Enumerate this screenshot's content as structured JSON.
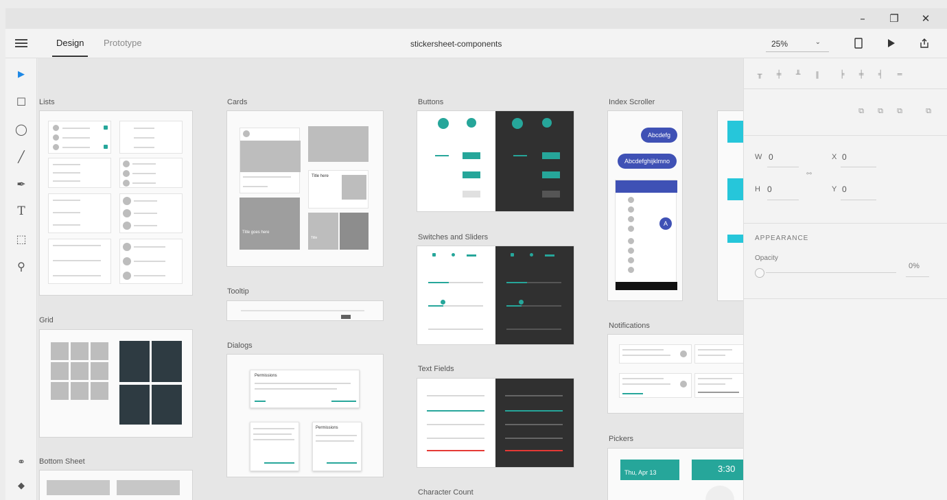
{
  "window": {
    "minimize": "–",
    "restore": "❐",
    "close": "✕"
  },
  "topbar": {
    "tabs": [
      {
        "label": "Design",
        "active": true
      },
      {
        "label": "Prototype",
        "active": false
      }
    ],
    "document_title": "stickersheet-components",
    "zoom": "25%",
    "zoom_chevron": "⌄",
    "device_icon": "device-preview-icon",
    "play_icon": "play-icon",
    "share_icon": "share-icon"
  },
  "tools": [
    {
      "name": "select-tool",
      "icon": "arrow-icon",
      "glyph": "▶"
    },
    {
      "name": "rectangle-tool",
      "icon": "rectangle-icon",
      "glyph": "☐"
    },
    {
      "name": "ellipse-tool",
      "icon": "ellipse-icon",
      "glyph": "◯"
    },
    {
      "name": "line-tool",
      "icon": "line-icon",
      "glyph": "╱"
    },
    {
      "name": "pen-tool",
      "icon": "pen-icon",
      "glyph": "✒"
    },
    {
      "name": "text-tool",
      "icon": "text-icon",
      "glyph": "T"
    },
    {
      "name": "artboard-tool",
      "icon": "artboard-icon",
      "glyph": "⬚"
    },
    {
      "name": "zoom-tool",
      "icon": "zoom-icon",
      "glyph": "⚲"
    }
  ],
  "bottom_tools": [
    {
      "name": "symbols-tool",
      "icon": "symbols-icon",
      "glyph": "⚭"
    },
    {
      "name": "layers-tool",
      "icon": "layers-icon",
      "glyph": "◆"
    }
  ],
  "artboards": {
    "lists": "Lists",
    "grid": "Grid",
    "bottom_sheet": "Bottom Sheet",
    "cards": "Cards",
    "tooltip": "Tooltip",
    "dialogs": "Dialogs",
    "buttons": "Buttons",
    "switches": "Switches and Sliders",
    "text_fields": "Text Fields",
    "character_count": "Character Count",
    "index_scroller": "Index Scroller",
    "notifications": "Notifications",
    "pickers": "Pickers"
  },
  "content": {
    "cards_title": "Title goes here",
    "cards_title2": "Title here",
    "cards_title3": "Title",
    "chip1": "Abcdefg",
    "chip2": "Abcdefghijklmno",
    "fab_letter": "A",
    "dialog_title": "Permissions",
    "dialog_title2": "Permissions",
    "picker_date": "Thu, Apr 13",
    "picker_time": "3:30"
  },
  "panel": {
    "w_label": "W",
    "w_value": "0",
    "x_label": "X",
    "x_value": "0",
    "h_label": "H",
    "h_value": "0",
    "y_label": "Y",
    "y_value": "0",
    "appearance": "APPEARANCE",
    "opacity_label": "Opacity",
    "opacity_value": "0%"
  },
  "colors": {
    "teal": "#26a69a",
    "indigo": "#3f51b5",
    "dark": "#303030",
    "accent_blue": "#1e88e5"
  }
}
